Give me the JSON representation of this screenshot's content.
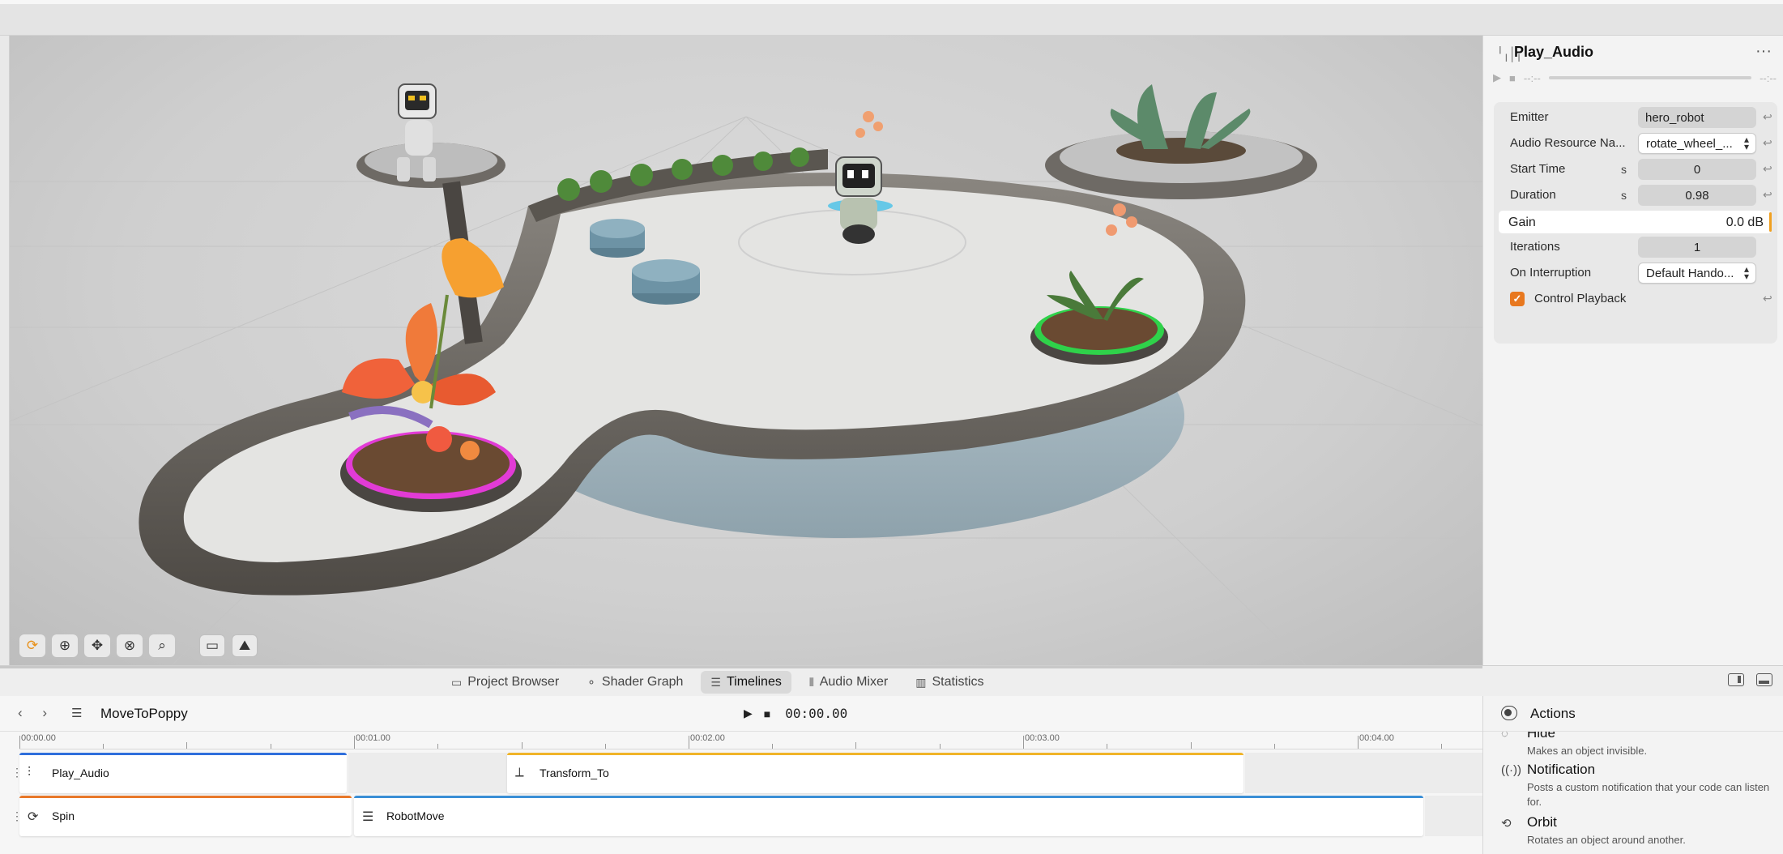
{
  "inspector": {
    "title": "Play_Audio",
    "player": {
      "time_left": "--:--",
      "time_right": "--:--"
    },
    "properties": [
      {
        "label": "Emitter",
        "unit": "",
        "value": "hero_robot",
        "kind": "field"
      },
      {
        "label": "Audio Resource Na...",
        "unit": "",
        "value": "rotate_wheel_...",
        "kind": "popup"
      },
      {
        "label": "Start Time",
        "unit": "s",
        "value": "0",
        "kind": "number"
      },
      {
        "label": "Duration",
        "unit": "s",
        "value": "0.98",
        "kind": "number"
      },
      {
        "label": "Iterations",
        "unit": "",
        "value": "1",
        "kind": "number"
      },
      {
        "label": "On Interruption",
        "unit": "",
        "value": "Default Hando...",
        "kind": "popup"
      }
    ],
    "gain": {
      "label": "Gain",
      "value": "0.0 dB"
    },
    "control_playback": {
      "label": "Control Playback",
      "checked": true
    }
  },
  "tabs": [
    {
      "label": "Project Browser",
      "icon": "folder-icon",
      "active": false
    },
    {
      "label": "Shader Graph",
      "icon": "shader-graph-icon",
      "active": false
    },
    {
      "label": "Timelines",
      "icon": "timeline-icon",
      "active": true
    },
    {
      "label": "Audio Mixer",
      "icon": "audio-mixer-icon",
      "active": false
    },
    {
      "label": "Statistics",
      "icon": "statistics-icon",
      "active": false
    }
  ],
  "timeline": {
    "name": "MoveToPoppy",
    "time": "00:00.00",
    "ruler_labels": [
      "00:00.00",
      "00:01.00",
      "00:02.00",
      "00:03.00",
      "00:04.00"
    ],
    "tracks": [
      {
        "clips": [
          {
            "name": "Play_Audio",
            "icon": "audio-wave-icon",
            "color": "#2f6fdc"
          },
          {
            "name": "Transform_To",
            "icon": "transform-icon",
            "color": "#f0b429"
          }
        ]
      },
      {
        "clips": [
          {
            "name": "Spin",
            "icon": "spin-icon",
            "color": "#e8782a"
          },
          {
            "name": "RobotMove",
            "icon": "group-icon",
            "color": "#3a8fd6"
          }
        ]
      }
    ]
  },
  "actions": {
    "title": "Actions",
    "items": [
      {
        "name": "Hide",
        "description": "Makes an object invisible.",
        "icon": "hide-icon"
      },
      {
        "name": "Notification",
        "description": "Posts a custom notification that your code can listen for.",
        "icon": "notification-icon"
      },
      {
        "name": "Orbit",
        "description": "Rotates an object around another.",
        "icon": "orbit-icon"
      }
    ]
  },
  "colors": {
    "accent": "#e8781f",
    "selected_ring_magenta": "#e23bd6",
    "selected_ring_green": "#2fd24a"
  }
}
